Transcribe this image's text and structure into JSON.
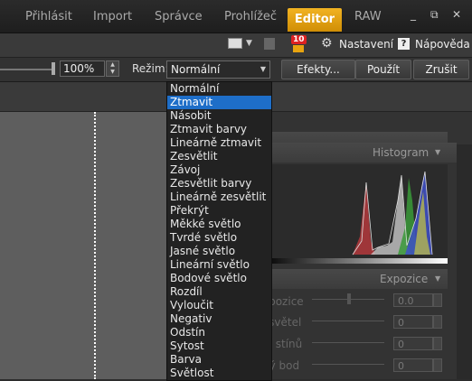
{
  "tabs": [
    "Přihlásit",
    "Import",
    "Správce",
    "Prohlížeč",
    "Editor",
    "RAW"
  ],
  "active_tab": "Editor",
  "window_controls": {
    "minimize": "_",
    "restore": "⧉",
    "close": "✕"
  },
  "toolbar": {
    "badge_count": "10",
    "settings_label": "Nastavení",
    "help_label": "Nápověda"
  },
  "options": {
    "opacity_value": "100%",
    "mode_label": "Režim:",
    "mode_value": "Normální",
    "effects_label": "Efekty...",
    "apply_label": "Použít",
    "cancel_label": "Zrušit"
  },
  "dropdown": {
    "selected": "Ztmavit",
    "items": [
      "Normální",
      "Ztmavit",
      "Násobit",
      "Ztmavit barvy",
      "Lineárně ztmavit",
      "Zesvětlit",
      "Závoj",
      "Zesvětlit barvy",
      "Lineárně zesvětlit",
      "Překrýt",
      "Měkké světlo",
      "Tvrdé světlo",
      "Jasné světlo",
      "Lineární světlo",
      "Bodové světlo",
      "Rozdíl",
      "Vyloučit",
      "Negativ",
      "Odstín",
      "Sytost",
      "Barva",
      "Světlost"
    ]
  },
  "histogram_label": "Histogram",
  "exposure_panel": {
    "title": "Expozice",
    "rows": [
      {
        "label": "xpozice",
        "value": "0.0"
      },
      {
        "label": "í světel",
        "value": "0"
      },
      {
        "label": "ní stínů",
        "value": "0"
      },
      {
        "label": "ný bod",
        "value": "0"
      }
    ]
  },
  "colors": {
    "accent": "#f0a81a",
    "selection": "#1e6ec8"
  }
}
